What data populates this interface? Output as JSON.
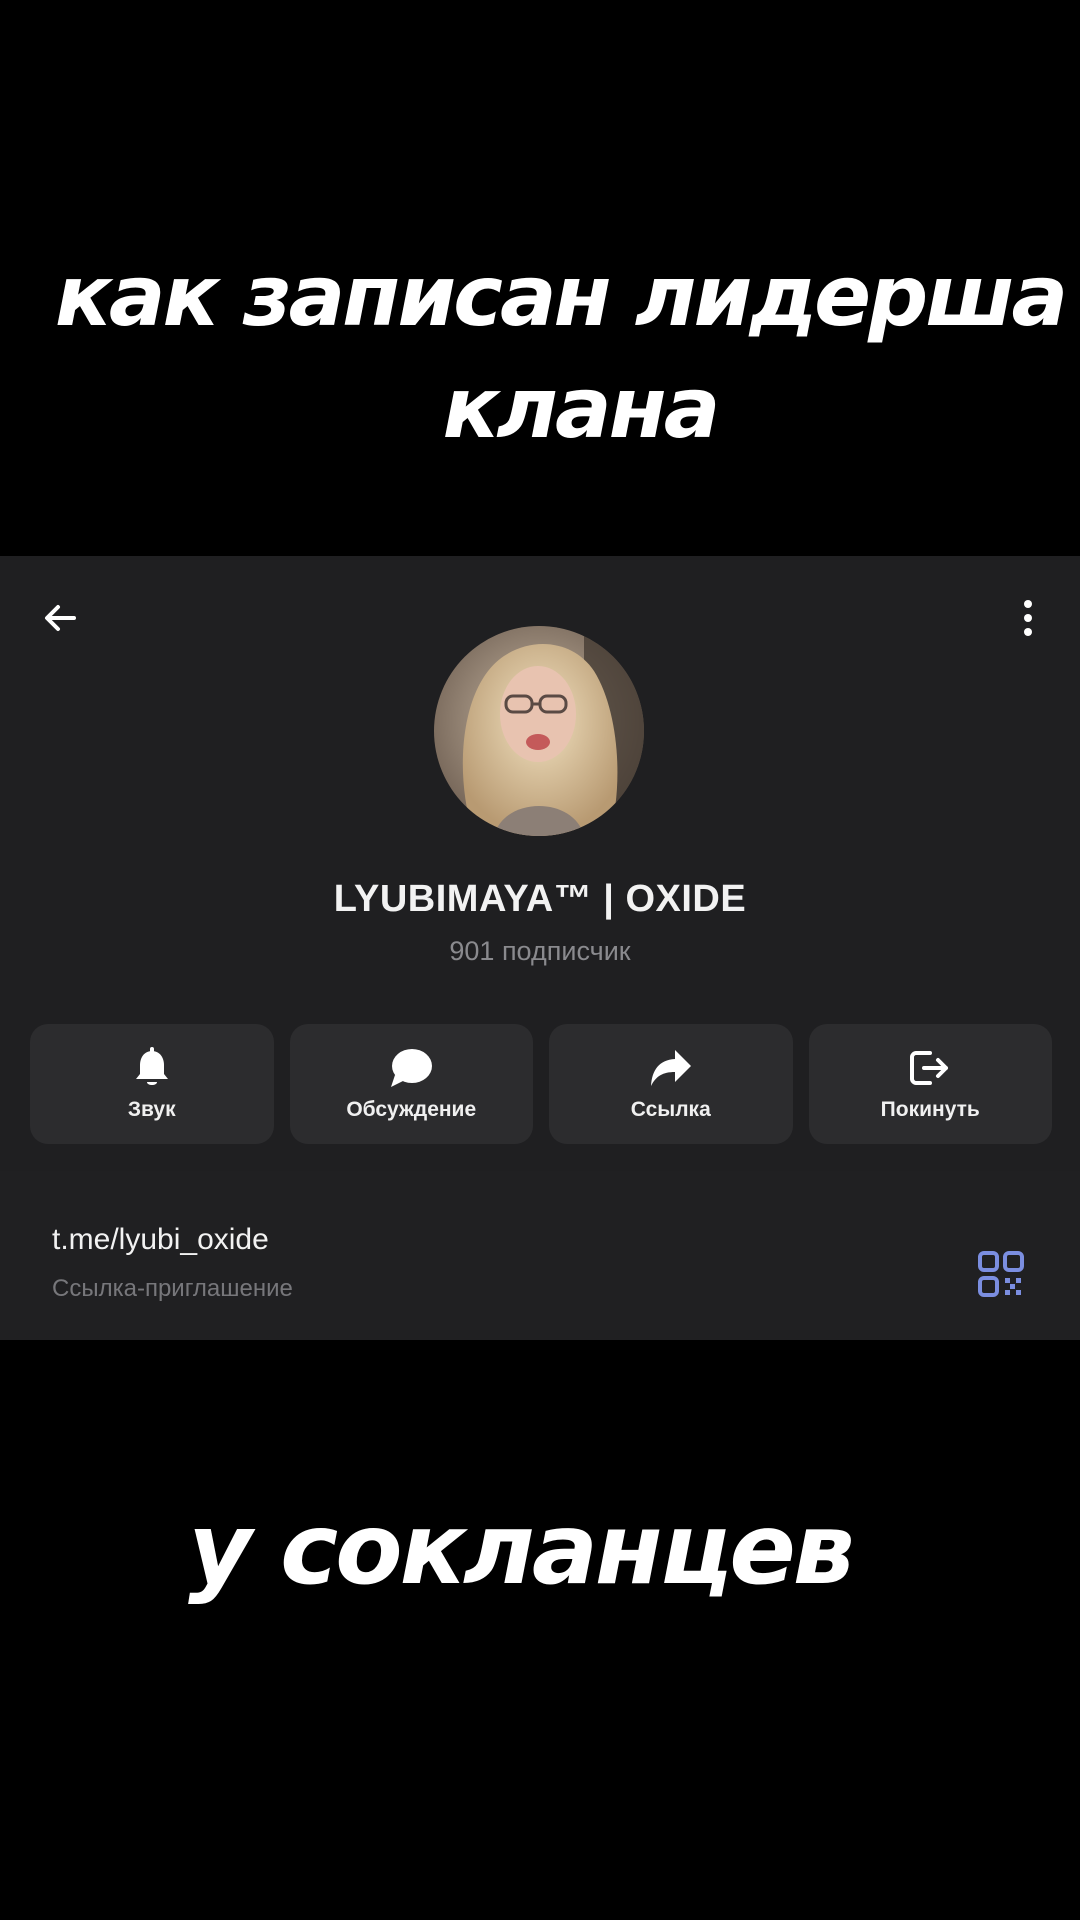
{
  "captions": {
    "top_line1": "как записан лидерша",
    "top_line2": "клана",
    "bottom": "у сокланцев"
  },
  "channel": {
    "name": "LYUBIMAYA™ | OXIDE",
    "subscribers": "901 подписчик"
  },
  "actions": [
    {
      "label": "Звук",
      "icon": "bell-icon"
    },
    {
      "label": "Обсуждение",
      "icon": "chat-bubble-icon"
    },
    {
      "label": "Ссылка",
      "icon": "share-arrow-icon"
    },
    {
      "label": "Покинуть",
      "icon": "leave-icon"
    }
  ],
  "link": {
    "url": "t.me/lyubi_oxide",
    "caption": "Ссылка-приглашение"
  },
  "colors": {
    "background": "#000000",
    "panel": "#1f1f21",
    "button": "#2c2c2e",
    "qr_accent": "#7b8ee0"
  }
}
